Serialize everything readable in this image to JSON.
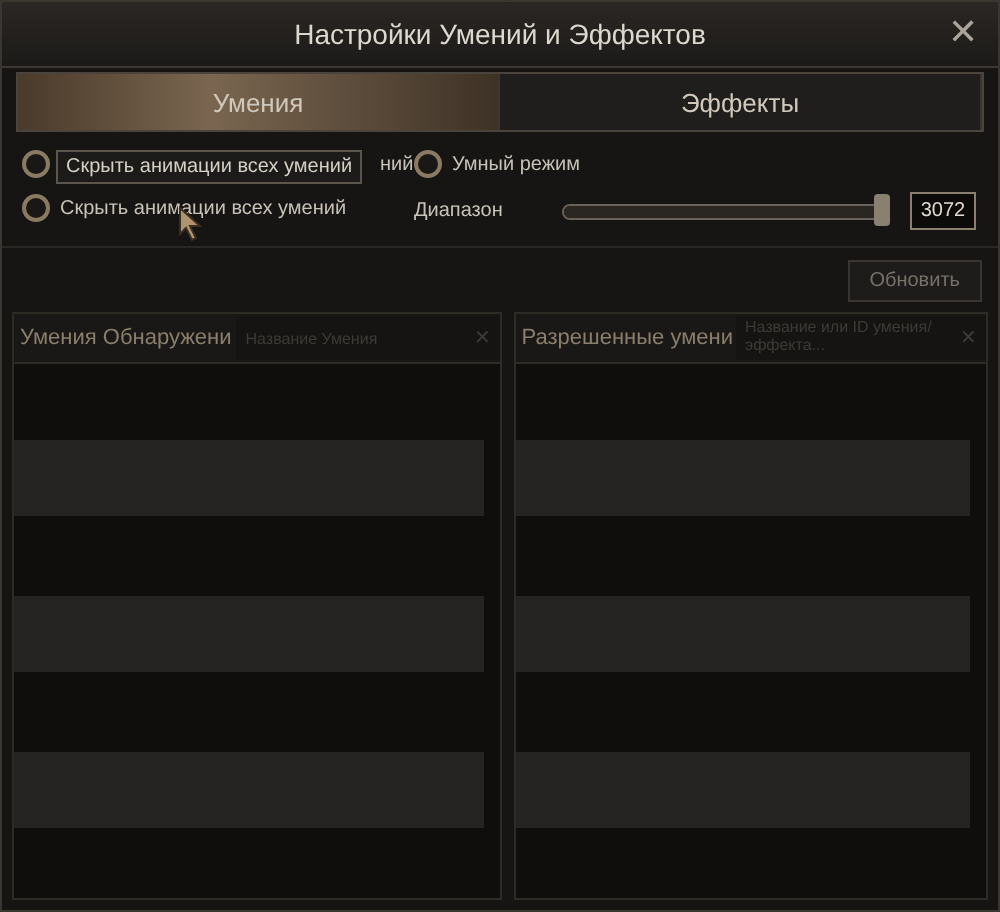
{
  "window": {
    "title": "Настройки Умений и Эффектов",
    "close": "✕"
  },
  "tabs": [
    {
      "label": "Умения",
      "selected": true
    },
    {
      "label": "Эффекты",
      "selected": false
    }
  ],
  "options": [
    {
      "label": "ний",
      "selected": false
    },
    {
      "label": "Скрыть анимации всех умений",
      "selected": false
    }
  ],
  "tooltip": "Скрыть анимации всех умений",
  "smart_mode": {
    "label": "Умный режим",
    "selected": false
  },
  "range": {
    "label": "Диапазон",
    "level": 1,
    "value": "3072"
  },
  "update_button": "Обновить",
  "panels": [
    {
      "title": "Умения Обнаружени",
      "placeholder": "Название Умения",
      "clear": "✕"
    },
    {
      "title": "Разрешенные умени",
      "placeholder": "Название или ID умения/эффекта...",
      "clear": "✕"
    }
  ]
}
